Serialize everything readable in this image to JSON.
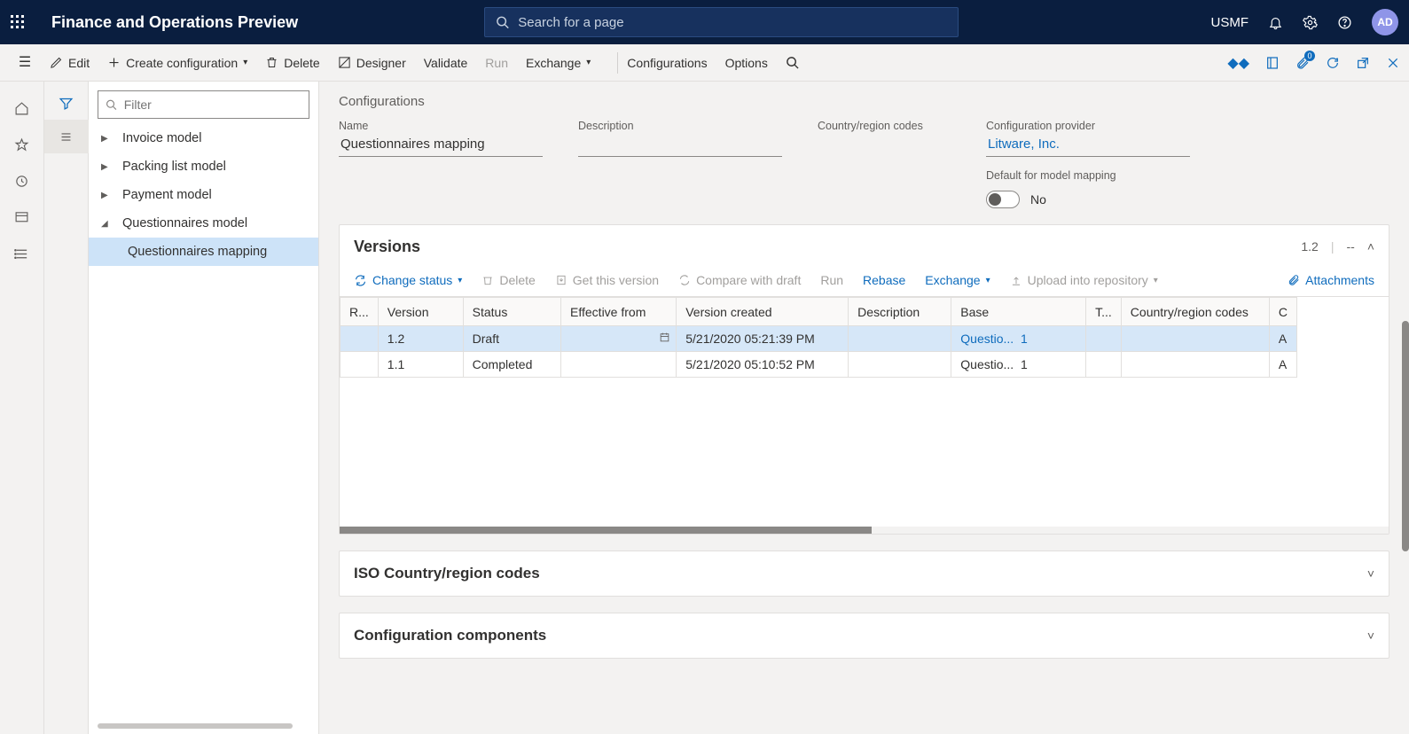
{
  "topbar": {
    "app_title": "Finance and Operations Preview",
    "search_placeholder": "Search for a page",
    "company": "USMF",
    "avatar": "AD"
  },
  "actionbar": {
    "edit": "Edit",
    "create": "Create configuration",
    "delete": "Delete",
    "designer": "Designer",
    "validate": "Validate",
    "run": "Run",
    "exchange": "Exchange",
    "configurations": "Configurations",
    "options": "Options"
  },
  "tree": {
    "filter_placeholder": "Filter",
    "items": [
      {
        "label": "Invoice model",
        "expanded": false
      },
      {
        "label": "Packing list model",
        "expanded": false
      },
      {
        "label": "Payment model",
        "expanded": false
      },
      {
        "label": "Questionnaires model",
        "expanded": true,
        "children": [
          {
            "label": "Questionnaires mapping",
            "selected": true
          }
        ]
      }
    ]
  },
  "config": {
    "heading": "Configurations",
    "labels": {
      "name": "Name",
      "description": "Description",
      "country": "Country/region codes",
      "provider": "Configuration provider",
      "defaultmm": "Default for model mapping"
    },
    "name": "Questionnaires mapping",
    "description": "",
    "country": "",
    "provider": "Litware, Inc.",
    "defaultmm_value": "No"
  },
  "versions": {
    "title": "Versions",
    "summary": "1.2",
    "dashes": "--",
    "toolbar": {
      "change": "Change status",
      "delete": "Delete",
      "getver": "Get this version",
      "compare": "Compare with draft",
      "run": "Run",
      "rebase": "Rebase",
      "exchange": "Exchange",
      "upload": "Upload into repository",
      "attach": "Attachments"
    },
    "columns": {
      "r": "R...",
      "version": "Version",
      "status": "Status",
      "effective": "Effective from",
      "created": "Version created",
      "description": "Description",
      "base": "Base",
      "t": "T...",
      "country": "Country/region codes",
      "c": "C"
    },
    "rows": [
      {
        "version": "1.2",
        "status": "Draft",
        "effective": "",
        "created": "5/21/2020 05:21:39 PM",
        "description": "",
        "base": "Questio...",
        "base_n": "1",
        "t": "",
        "country": "",
        "c": "A",
        "selected": true
      },
      {
        "version": "1.1",
        "status": "Completed",
        "effective": "",
        "created": "5/21/2020 05:10:52 PM",
        "description": "",
        "base": "Questio...",
        "base_n": "1",
        "t": "",
        "country": "",
        "c": "A",
        "selected": false
      }
    ]
  },
  "sections": {
    "iso": "ISO Country/region codes",
    "components": "Configuration components"
  }
}
